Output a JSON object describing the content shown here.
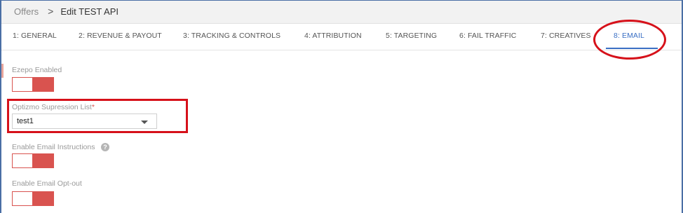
{
  "breadcrumb": {
    "parent": "Offers",
    "separator": ">",
    "current": "Edit TEST API"
  },
  "tabs": [
    {
      "label": "1: GENERAL"
    },
    {
      "label": "2: REVENUE & PAYOUT"
    },
    {
      "label": "3: TRACKING & CONTROLS"
    },
    {
      "label": "4: ATTRIBUTION"
    },
    {
      "label": "5: TARGETING"
    },
    {
      "label": "6: FAIL TRAFFIC"
    },
    {
      "label": "7: CREATIVES"
    },
    {
      "label": "8: EMAIL"
    }
  ],
  "active_tab": "8: EMAIL",
  "form": {
    "ezepo_label": "Ezepo Enabled",
    "ezepo_state": "on",
    "optizmo_label": "Optizmo Supression List",
    "required_mark": "*",
    "optizmo_value": "test1",
    "email_instructions_label": "Enable Email Instructions",
    "email_instructions_state": "on",
    "email_optout_label": "Enable Email Opt-out",
    "email_optout_state": "on",
    "help_glyph": "?"
  },
  "colors": {
    "accent": "#3a6fc4",
    "toggle": "#d9534f",
    "annotation": "#d6111a"
  }
}
